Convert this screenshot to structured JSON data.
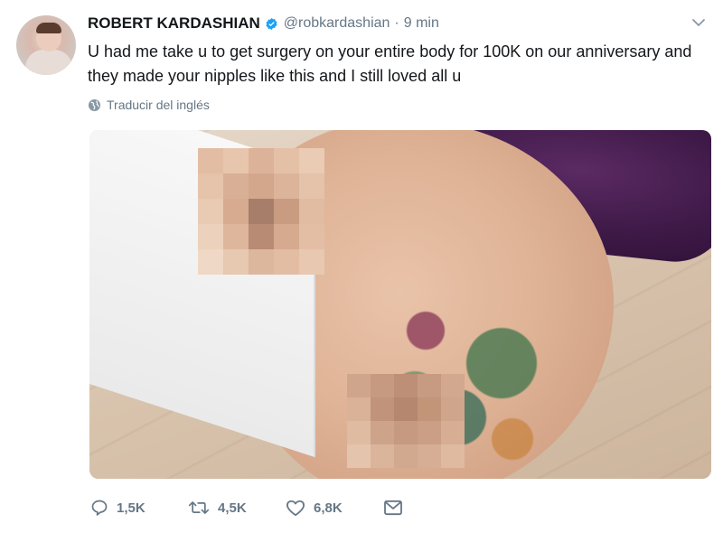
{
  "tweet": {
    "author_name": "ROBERT KARDASHIAN",
    "handle": "@robkardashian",
    "separator": "·",
    "time": "9 min",
    "text": "U had me take u to get surgery on your entire body for 100K on our anniversary and they made your nipples like this and I still loved all u",
    "translate_label": "Traducir del inglés"
  },
  "actions": {
    "replies": "1,5K",
    "retweets": "4,5K",
    "likes": "6,8K"
  },
  "icons": {
    "verified": "verified-badge-icon",
    "caret": "chevron-down-icon",
    "globe": "globe-icon",
    "reply": "reply-icon",
    "retweet": "retweet-icon",
    "like": "heart-icon",
    "dm": "envelope-icon"
  },
  "colors": {
    "verified_blue": "#1da1f2",
    "secondary_text": "#657786",
    "primary_text": "#14171a"
  }
}
